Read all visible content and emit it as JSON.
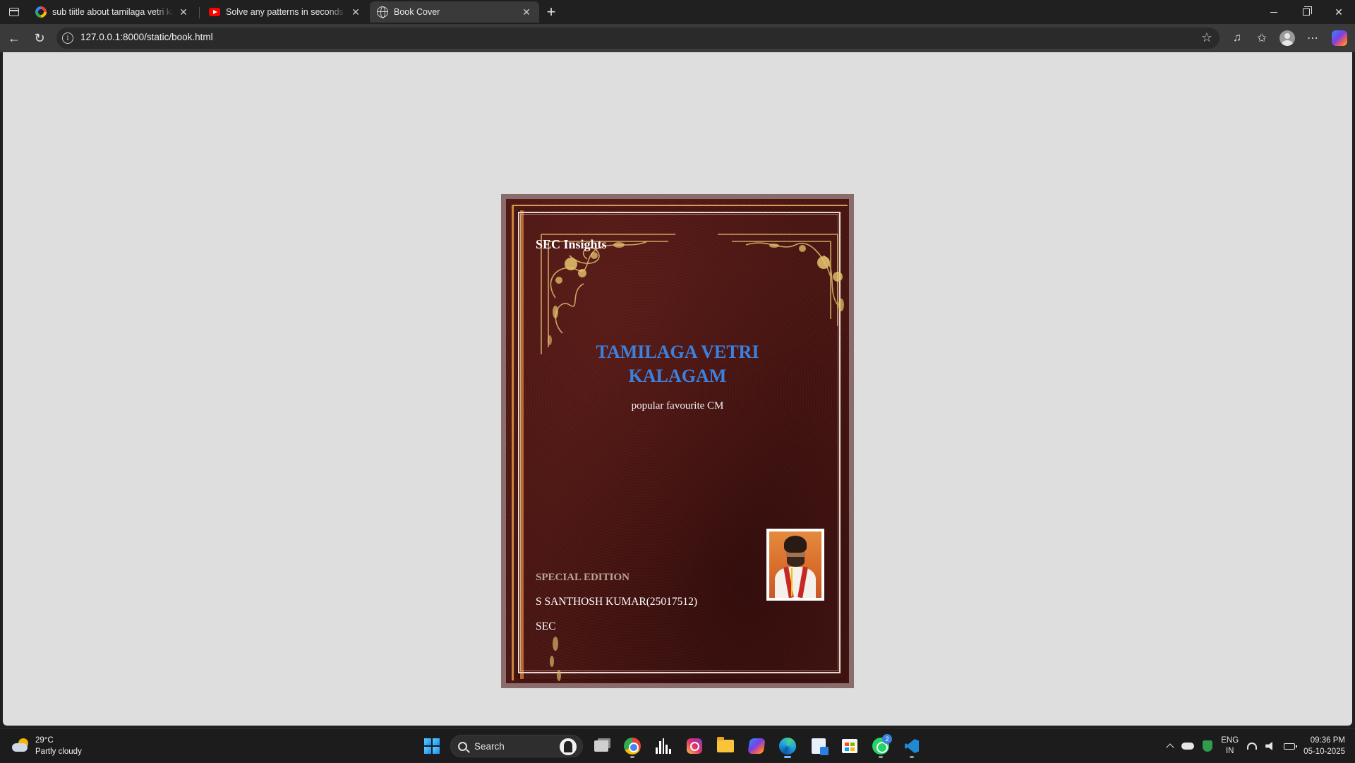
{
  "browser": {
    "tabs": [
      {
        "title": "sub tiitle about tamilaga vetri kalagam",
        "favicon": "google-icon",
        "active": false
      },
      {
        "title": "Solve any patterns in seconds with",
        "favicon": "youtube-icon",
        "active": false
      },
      {
        "title": "Book Cover",
        "favicon": "globe-icon",
        "active": true
      }
    ],
    "address_bar": {
      "url": "127.0.0.1:8000/static/book.html"
    }
  },
  "book": {
    "brand": "SEC Insights",
    "title_line1": "TAMILAGA VETRI",
    "title_line2": "KALAGAM",
    "subtitle": "popular favourite CM",
    "edition": "SPECIAL EDITION",
    "author": "S SANTHOSH KUMAR(25017512)",
    "organization": "SEC",
    "colors": {
      "cover": "#4a1512",
      "title": "#3b82e0",
      "frame_gold": "#c9873f"
    }
  },
  "taskbar": {
    "weather": {
      "temp": "29°C",
      "condition": "Partly cloudy"
    },
    "search_label": "Search",
    "whatsapp_badge": "2",
    "tray": {
      "lang_line1": "ENG",
      "lang_line2": "IN",
      "time": "09:36 PM",
      "date": "05-10-2025"
    }
  }
}
